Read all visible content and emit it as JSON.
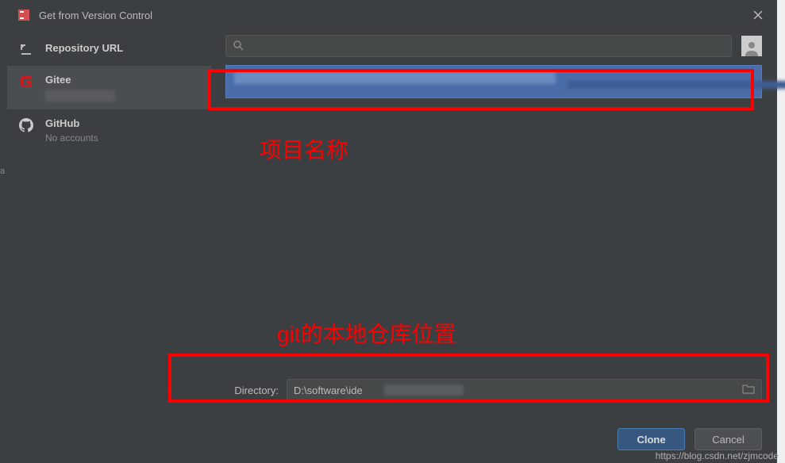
{
  "titlebar": {
    "title": "Get from Version Control"
  },
  "sidebar": {
    "items": [
      {
        "label": "Repository URL",
        "sub": ""
      },
      {
        "label": "Gitee",
        "sub": ""
      },
      {
        "label": "GitHub",
        "sub": "No accounts"
      }
    ]
  },
  "search": {
    "placeholder": ""
  },
  "directory": {
    "label": "Directory:",
    "value": "D:\\software\\ide"
  },
  "buttons": {
    "clone": "Clone",
    "cancel": "Cancel"
  },
  "annotations": {
    "text1": "项目名称",
    "text2": "git的本地仓库位置"
  },
  "watermark": "https://blog.csdn.net/zjmcode",
  "bgstrip": {
    "a": "a"
  }
}
